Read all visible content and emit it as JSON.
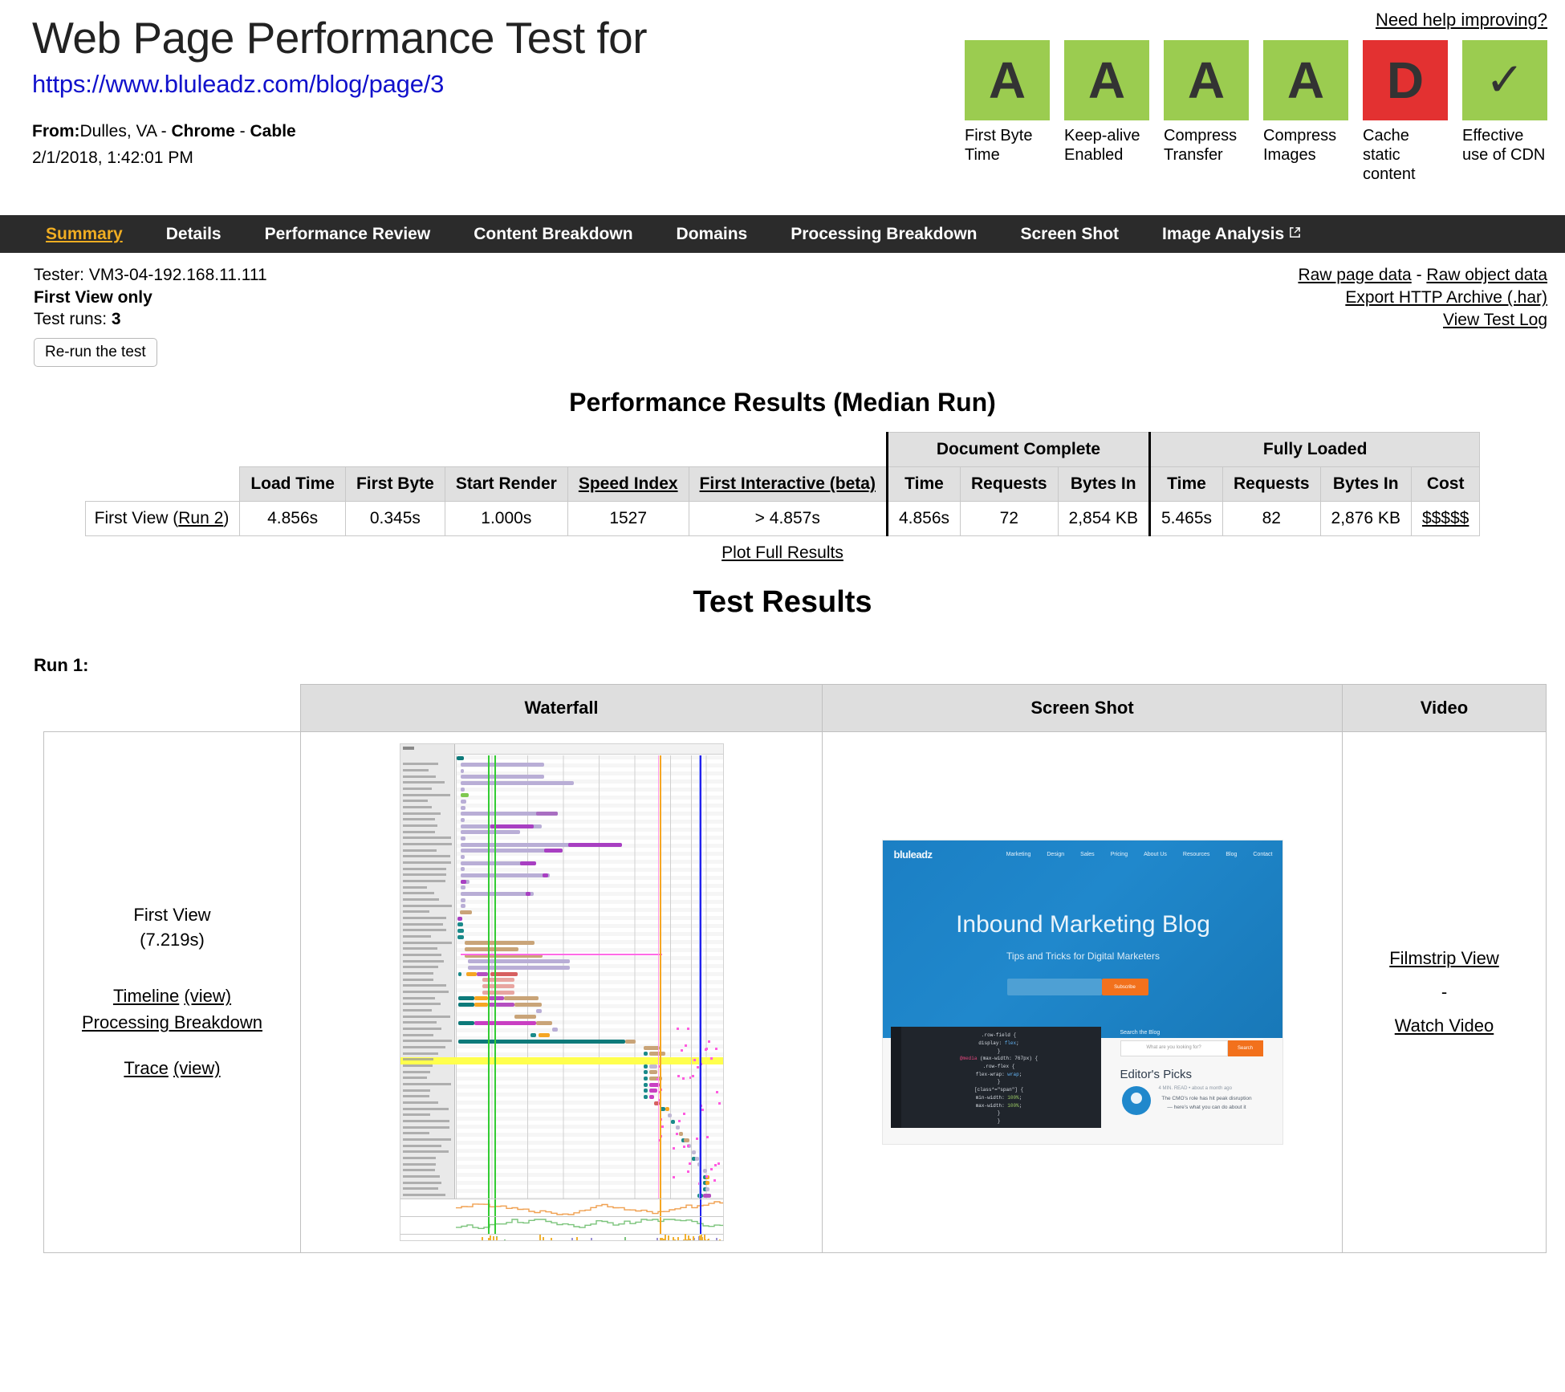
{
  "header": {
    "title": "Web Page Performance Test for",
    "url": "https://www.bluleadz.com/blog/page/3",
    "from_label": "From:",
    "from_location": "Dulles, VA - ",
    "from_browser": "Chrome",
    "from_sep": " - ",
    "from_connection": "Cable",
    "test_date": "2/1/2018, 1:42:01 PM",
    "need_help_link": "Need help improving?",
    "grades": [
      {
        "grade": "A",
        "label": "First Byte Time",
        "color": "#9bcc50"
      },
      {
        "grade": "A",
        "label": "Keep-alive Enabled",
        "color": "#9bcc50"
      },
      {
        "grade": "A",
        "label": "Compress Transfer",
        "color": "#9bcc50"
      },
      {
        "grade": "A",
        "label": "Compress Images",
        "color": "#9bcc50"
      },
      {
        "grade": "D",
        "label": "Cache static content",
        "color": "#e33131"
      },
      {
        "grade": "✓",
        "label": "Effective use of CDN",
        "color": "#9bcc50"
      }
    ]
  },
  "nav": {
    "active_accent": "#f0ad22",
    "background": "#2b2b2b",
    "items": [
      {
        "label": "Summary",
        "active": true,
        "external": false
      },
      {
        "label": "Details",
        "active": false,
        "external": false
      },
      {
        "label": "Performance Review",
        "active": false,
        "external": false
      },
      {
        "label": "Content Breakdown",
        "active": false,
        "external": false
      },
      {
        "label": "Domains",
        "active": false,
        "external": false
      },
      {
        "label": "Processing Breakdown",
        "active": false,
        "external": false
      },
      {
        "label": "Screen Shot",
        "active": false,
        "external": false
      },
      {
        "label": "Image Analysis",
        "active": false,
        "external": true
      }
    ]
  },
  "meta": {
    "tester": "Tester: VM3-04-192.168.11.111",
    "view_mode": "First View only",
    "test_runs_label": "Test runs: ",
    "test_runs_value": "3",
    "rerun_button": "Re-run the test",
    "links": {
      "raw_page_data": "Raw page data",
      "dash": " - ",
      "raw_object_data": "Raw object data",
      "export_har": "Export HTTP Archive (.har)",
      "view_test_log": "View Test Log"
    }
  },
  "performance": {
    "title": "Performance Results (Median Run)",
    "group_headers": {
      "document_complete": "Document Complete",
      "fully_loaded": "Fully Loaded"
    },
    "columns": [
      "Load Time",
      "First Byte",
      "Start Render",
      "Speed Index",
      "First Interactive (beta)",
      "Time",
      "Requests",
      "Bytes In",
      "Time",
      "Requests",
      "Bytes In",
      "Cost"
    ],
    "row_label_prefix": "First View (",
    "row_label_link": "Run 2",
    "row_label_suffix": ")",
    "values": [
      "4.856s",
      "0.345s",
      "1.000s",
      "1527",
      "> 4.857s",
      "4.856s",
      "72",
      "2,854 KB",
      "5.465s",
      "82",
      "2,876 KB",
      "$$$$$"
    ],
    "plot_full_results": "Plot Full Results"
  },
  "test_results": {
    "title": "Test Results",
    "run_label": "Run 1:",
    "table_headers": {
      "blank": "",
      "waterfall": "Waterfall",
      "screenshot": "Screen Shot",
      "video": "Video"
    },
    "first_view": {
      "name": "First View",
      "time": "(7.219s)",
      "timeline": "Timeline",
      "timeline_view": "(view)",
      "processing_breakdown": "Processing Breakdown",
      "trace": "Trace",
      "trace_view": "(view)"
    },
    "video": {
      "filmstrip": "Filmstrip View",
      "separator": "-",
      "watch_video": "Watch Video"
    }
  },
  "screenshot_thumb": {
    "logo": "bluleadz",
    "nav": [
      "Marketing",
      "Design",
      "Sales",
      "Pricing",
      "About Us",
      "Resources",
      "Blog",
      "Contact"
    ],
    "hero_title": "Inbound Marketing Blog",
    "hero_subtitle": "Tips and Tricks for Digital Marketers",
    "subscribe_button": "Subscribe",
    "search_label": "Search the Blog",
    "search_placeholder": "What are you looking for?",
    "search_button": "Search",
    "editors_picks": "Editor's Picks",
    "pick_meta": "4 MIN. READ • about a month ago",
    "pick_text": "The CMO’s role has hit peak disruption — here’s what you can do about it",
    "code_lines": [
      ".row-field {",
      "  display: flex;",
      "}",
      "@media (max-width: 767px) {",
      "  .row-flex {",
      "    flex-wrap: wrap;",
      "  }",
      "  [class*=\"span\"] {",
      "    min-width: 100%;",
      "    max-width: 100%;",
      "  }",
      "}"
    ]
  },
  "waterfall_chart": {
    "type": "waterfall",
    "rows": 72,
    "gridlines": 9,
    "markers": {
      "start_render": {
        "color": "#33cc33",
        "x_pct": 12.0
      },
      "dom_interactive": {
        "color": "#33cc33",
        "x_pct": 14.5
      },
      "document_complete": {
        "color": "#f5a623",
        "x_pct": 76.0
      },
      "fully_loaded": {
        "color": "#2222ee",
        "x_pct": 91.0
      }
    },
    "bar_colors": {
      "dns": "#1a8a8a",
      "connect": "#f5a623",
      "ssl": "#b44fc0",
      "html": "#0d7a7a",
      "js": "#c9a478",
      "css": "#cbb08a",
      "image": "#b9aed6",
      "font": "#d76060",
      "other": "#c0b8d4"
    },
    "highlight_row_color": "#ffff4d",
    "bottom_panels": [
      "Bandwidth In",
      "CPU Utilization",
      "Browser Main Thread"
    ]
  }
}
